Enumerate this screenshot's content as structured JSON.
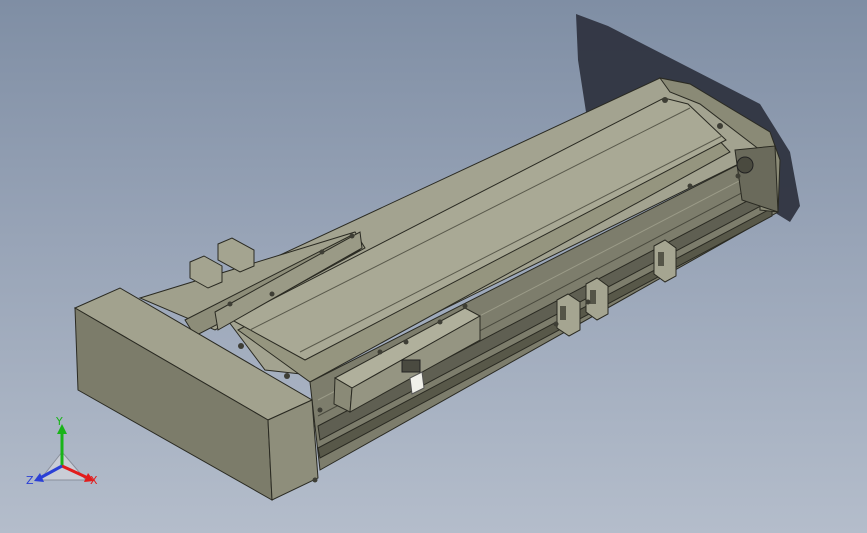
{
  "viewport": {
    "background_top": "#7f8ea4",
    "background_bottom": "#b4bdcb"
  },
  "model": {
    "kind": "linear actuator module",
    "body_color": "#8f8f7c",
    "top_color": "#a3a390",
    "side_color": "#6e6e60",
    "shadow_color": "#2f3440"
  },
  "triad": {
    "x_label": "X",
    "y_label": "Y",
    "z_label": "Z",
    "x_color": "#e21c1c",
    "y_color": "#19b419",
    "z_color": "#2a3fd6"
  }
}
